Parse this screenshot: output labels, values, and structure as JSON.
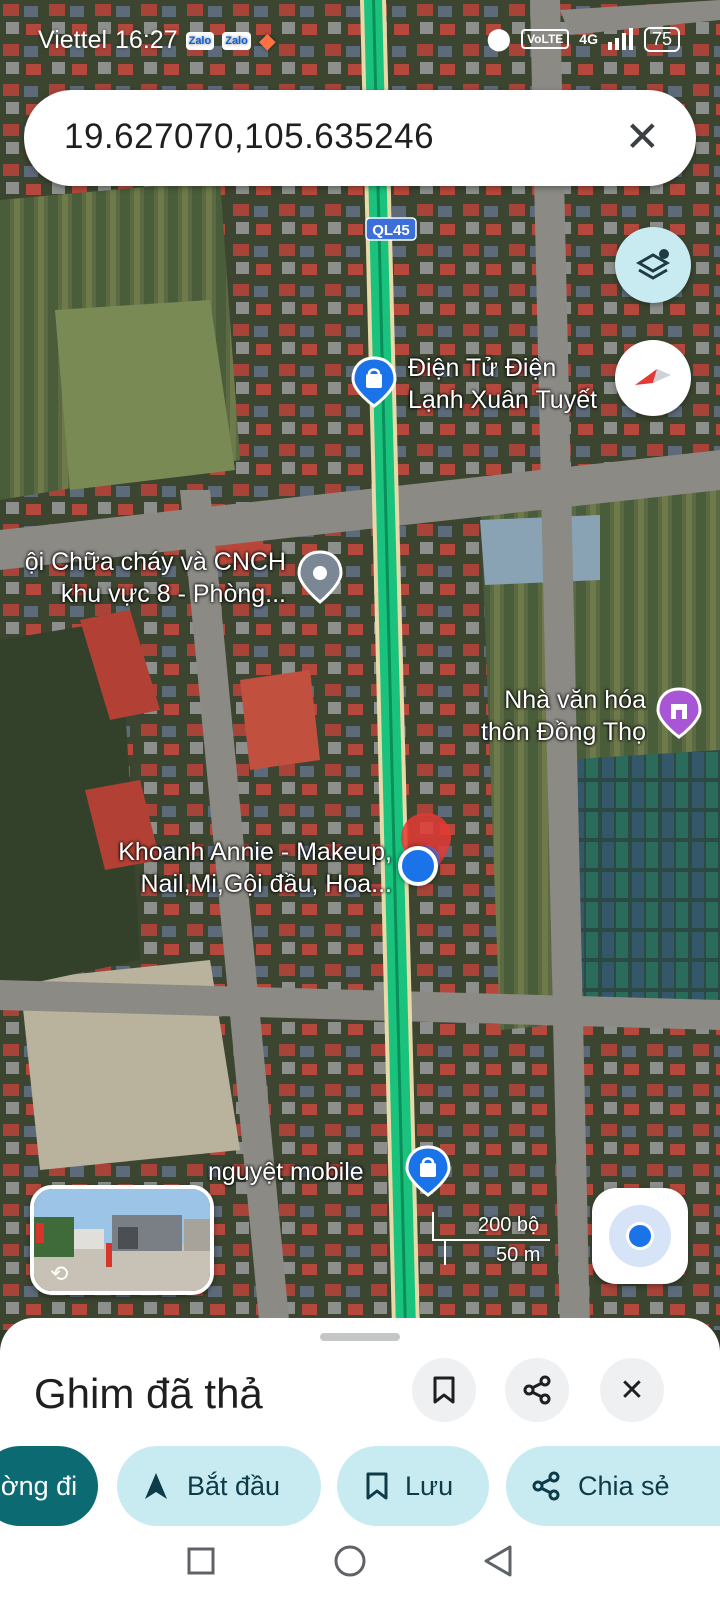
{
  "status_bar": {
    "carrier": "Viettel",
    "time": "16:27",
    "notif_icons": [
      "Zalo",
      "Zalo"
    ],
    "volte": "VoLTE",
    "network": "4G",
    "battery": "75"
  },
  "search": {
    "query": "19.627070,105.635246"
  },
  "map": {
    "road_shield": "QL45",
    "places": [
      {
        "line1": "Điện Tử Điện",
        "line2": "Lạnh Xuân Tuyết"
      },
      {
        "line1": "ội Chữa cháy và CNCH",
        "line2": "khu vực 8 - Phòng..."
      },
      {
        "line1": "Nhà văn hóa",
        "line2": "thôn Đồng Thọ"
      },
      {
        "line1": "Khoanh Annie - Makeup,",
        "line2": "Nail,Mi,Gội đầu, Hoa..."
      },
      {
        "line1": "nguyệt mobile"
      }
    ],
    "scale": {
      "imperial": "200 bộ",
      "metric": "50 m"
    }
  },
  "sheet": {
    "title": "Ghim đã thả",
    "actions": [
      {
        "label": "ờng đi",
        "icon": "directions-icon"
      },
      {
        "label": "Bắt đầu",
        "icon": "navigation-arrow-icon"
      },
      {
        "label": "Lưu",
        "icon": "bookmark-icon"
      },
      {
        "label": "Chia sẻ",
        "icon": "share-icon"
      }
    ]
  },
  "colors": {
    "route": "#19c37d",
    "accent": "#0b6a72",
    "chip": "#c8ebf2",
    "pin_red": "#e53935",
    "location_blue": "#1a73e8"
  }
}
